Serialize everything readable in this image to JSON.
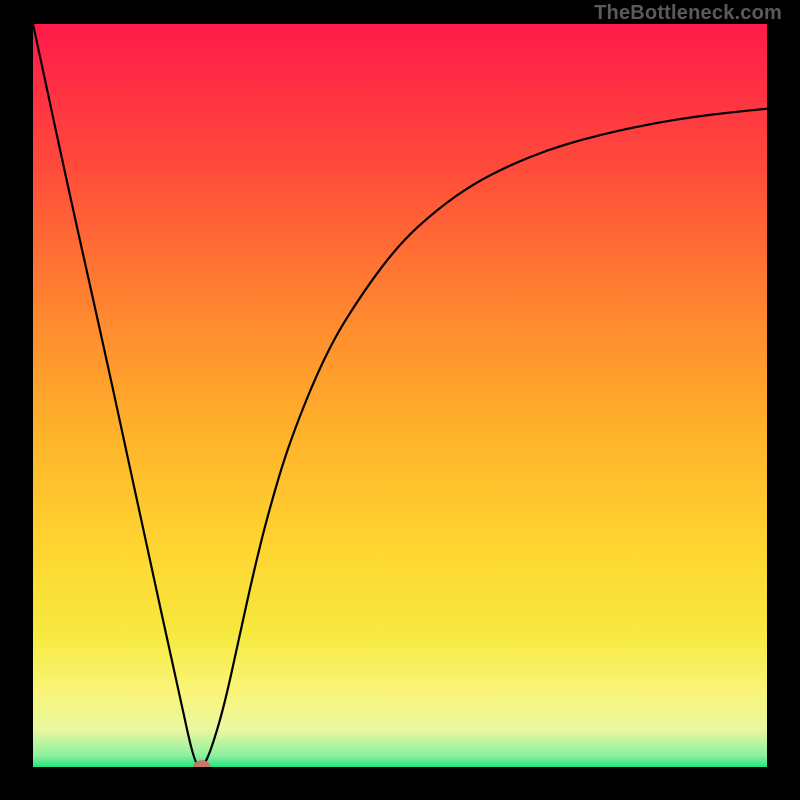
{
  "watermark": "TheBottleneck.com",
  "chart_data": {
    "type": "line",
    "title": "",
    "xlabel": "",
    "ylabel": "",
    "xlim": [
      0,
      100
    ],
    "ylim": [
      0,
      100
    ],
    "grid": false,
    "legend": false,
    "background": {
      "type": "vertical_gradient",
      "stops": [
        {
          "pos": 0.0,
          "color": "#ff1a4a"
        },
        {
          "pos": 0.2,
          "color": "#ff4d3a"
        },
        {
          "pos": 0.4,
          "color": "#ff8a2f"
        },
        {
          "pos": 0.55,
          "color": "#ffb22a"
        },
        {
          "pos": 0.7,
          "color": "#ffd430"
        },
        {
          "pos": 0.82,
          "color": "#f7e93f"
        },
        {
          "pos": 0.9,
          "color": "#f9f57a"
        },
        {
          "pos": 0.95,
          "color": "#e9f8a0"
        },
        {
          "pos": 0.985,
          "color": "#8cf0a0"
        },
        {
          "pos": 1.0,
          "color": "#22e57b"
        }
      ]
    },
    "series": [
      {
        "name": "bottleneck-curve",
        "color": "#000000",
        "x": [
          0,
          5,
          10,
          15,
          20,
          22,
          23,
          24,
          26,
          28,
          30,
          32,
          35,
          40,
          45,
          50,
          55,
          60,
          65,
          70,
          75,
          80,
          85,
          90,
          95,
          100
        ],
        "y": [
          100,
          77,
          55,
          32,
          9.5,
          0.5,
          0,
          1.5,
          8,
          17,
          26,
          34,
          44,
          56,
          64,
          70.5,
          75,
          78.5,
          81,
          83,
          84.5,
          85.7,
          86.7,
          87.5,
          88.1,
          88.6
        ]
      }
    ],
    "marker": {
      "name": "optimum-point",
      "x": 23,
      "y": 0,
      "color": "#c9756a",
      "rx": 1.2,
      "ry": 0.9
    }
  }
}
